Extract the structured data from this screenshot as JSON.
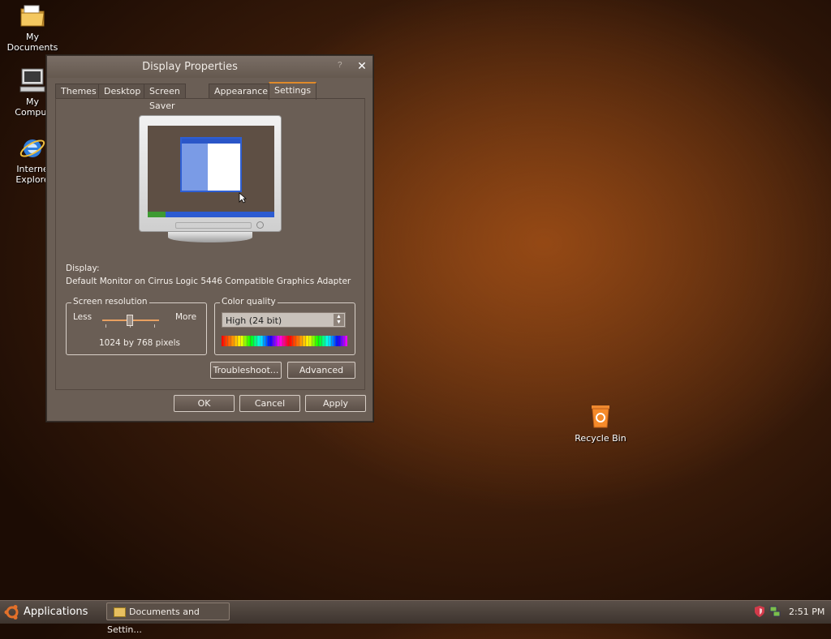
{
  "desktop": {
    "icons": [
      {
        "label_line1": "My",
        "label_line2": "Documents"
      },
      {
        "label_line1": "My",
        "label_line2": "Comput"
      },
      {
        "label_line1": "Interne",
        "label_line2": "Explore"
      },
      {
        "label_line1": "Recycle Bin",
        "label_line2": ""
      }
    ]
  },
  "dialog": {
    "title": "Display Properties",
    "help": "?",
    "close": "✕",
    "tabs": [
      "Themes",
      "Desktop",
      "Screen Saver",
      "Appearance",
      "Settings"
    ],
    "active_tab": "Settings",
    "display_label": "Display:",
    "display_value": "Default Monitor on Cirrus Logic 5446 Compatible Graphics Adapter",
    "resolution": {
      "group_title": "Screen resolution",
      "less": "Less",
      "more": "More",
      "value_text": "1024 by 768 pixels",
      "slider_fraction": 0.5
    },
    "color_quality": {
      "group_title": "Color quality",
      "selected": "High (24 bit)"
    },
    "buttons": {
      "troubleshoot": "Troubleshoot...",
      "advanced": "Advanced",
      "ok": "OK",
      "cancel": "Cancel",
      "apply": "Apply"
    }
  },
  "taskbar": {
    "applications": "Applications",
    "task_button": "Documents and Settin...",
    "clock": "2:51 PM"
  },
  "colors": {
    "accent": "#e08a2a",
    "dialog_bg": "#6a5e55"
  }
}
